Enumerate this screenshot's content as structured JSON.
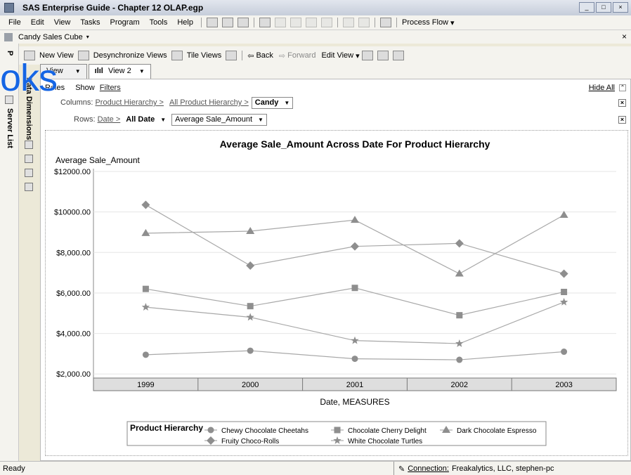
{
  "window": {
    "title": "SAS Enterprise Guide - Chapter 12 OLAP.egp"
  },
  "menu": {
    "items": [
      "File",
      "Edit",
      "View",
      "Tasks",
      "Program",
      "Tools",
      "Help"
    ],
    "process_flow": "Process Flow"
  },
  "document": {
    "name": "Candy Sales Cube"
  },
  "left_panel": {
    "server_list": "Server List",
    "data_dimensions": "Data Dimensions",
    "project": "P"
  },
  "toolbar": {
    "new_view": "New View",
    "desync": "Desynchronize Views",
    "tile": "Tile Views",
    "back": "Back",
    "forward": "Forward",
    "edit_view": "Edit View"
  },
  "tabs": [
    {
      "label": "View"
    },
    {
      "label": "View 2"
    }
  ],
  "roles": {
    "roles": "Roles",
    "show": "Show",
    "filters": "Filters",
    "hide_all": "Hide All"
  },
  "columns_row": {
    "label": "Columns:",
    "crumb1": "Product Hierarchy >",
    "crumb2": "All Product Hierarchy >",
    "value": "Candy"
  },
  "rows_row": {
    "label": "Rows:",
    "crumb1": "Date >",
    "value": "All Date",
    "measure": "Average Sale_Amount"
  },
  "status": {
    "ready": "Ready",
    "connection_label": "Connection:",
    "connection": "Freakalytics, LLC, stephen-pc"
  },
  "watermark": {
    "text": "oks"
  },
  "colors": {
    "series": "#8e8e8e",
    "axis_bg": "#dedede",
    "chart_bg": "#ffffff"
  },
  "chart_data": {
    "type": "line",
    "title": "Average Sale_Amount Across Date For Product Hierarchy",
    "ylabel": "Average Sale_Amount",
    "xlabel": "Date, MEASURES",
    "ylim": [
      1800,
      12000
    ],
    "yticks": [
      "$12000.00",
      "$10000.00",
      "$8,000.00",
      "$6,000.00",
      "$4,000.00",
      "$2,000.00"
    ],
    "ytick_values": [
      12000,
      10000,
      8000,
      6000,
      4000,
      2000
    ],
    "categories": [
      "1999",
      "2000",
      "2001",
      "2002",
      "2003"
    ],
    "legend_title": "Product Hierarchy",
    "legend_position": "bottom",
    "grid": true,
    "series": [
      {
        "name": "Chewy Chocolate Cheetahs",
        "marker": "circle",
        "values": [
          2950,
          3150,
          2750,
          2700,
          3100
        ]
      },
      {
        "name": "Chocolate Cherry Delight",
        "marker": "square",
        "values": [
          6200,
          5350,
          6250,
          4900,
          6050
        ]
      },
      {
        "name": "Dark Chocolate Espresso",
        "marker": "triangle",
        "values": [
          8950,
          9050,
          9600,
          6950,
          9850
        ]
      },
      {
        "name": "Fruity Choco-Rolls",
        "marker": "diamond",
        "values": [
          10350,
          7350,
          8300,
          8450,
          6950
        ]
      },
      {
        "name": "White Chocolate Turtles",
        "marker": "star",
        "values": [
          5300,
          4800,
          3650,
          3500,
          5550
        ]
      }
    ]
  }
}
